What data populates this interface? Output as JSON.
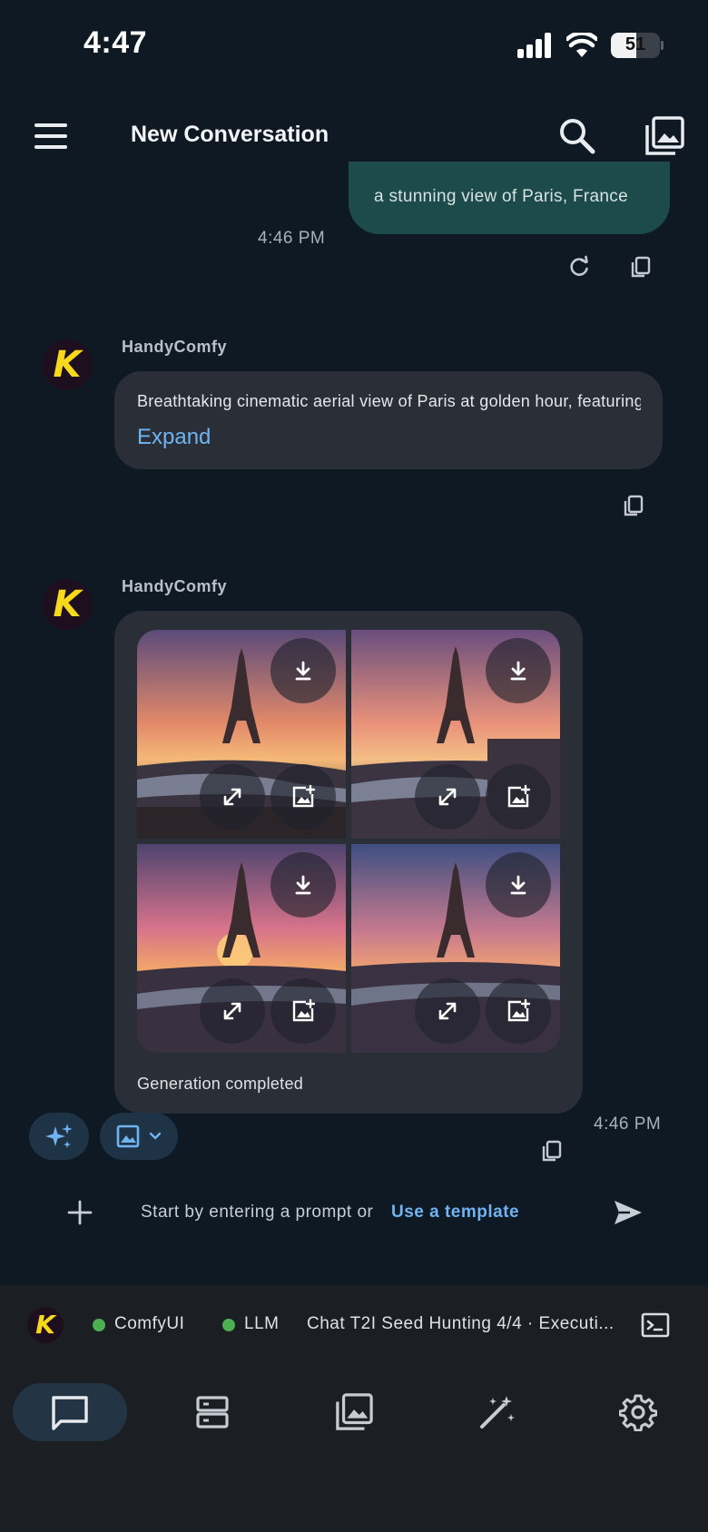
{
  "status_bar": {
    "time": "4:47",
    "battery": "51"
  },
  "header": {
    "title": "New Conversation"
  },
  "user_message": {
    "text": "a stunning view of Paris, France",
    "time": "4:46 PM"
  },
  "assistant_messages": [
    {
      "sender": "HandyComfy",
      "text": "Breathtaking cinematic aerial view of Paris at golden hour, featuring the Eiffel Tower",
      "expand_label": "Expand"
    },
    {
      "sender": "HandyComfy",
      "status": "Generation completed",
      "time": "4:46 PM",
      "images": [
        "paris-1",
        "paris-2",
        "paris-3",
        "paris-4"
      ]
    }
  ],
  "avatar_letter": "K",
  "input": {
    "placeholder": "Start by entering a prompt or",
    "template_link": "Use a template"
  },
  "connection": {
    "comfyui_label": "ComfyUI",
    "llm_label": "LLM",
    "task": "Chat T2I Seed Hunting 4/4 · Executi..."
  },
  "colors": {
    "accent": "#6fb3f0",
    "user_bubble": "#1d4a4a",
    "status_ok": "#4caf50",
    "logo": "#f7d81c"
  }
}
